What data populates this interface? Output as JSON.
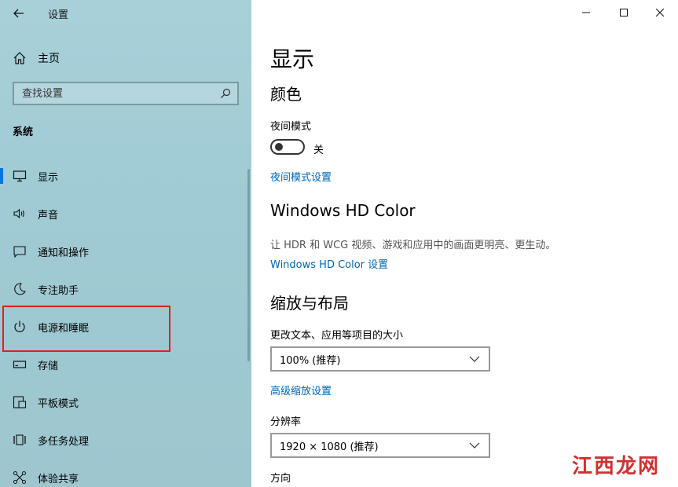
{
  "window": {
    "title": "设置"
  },
  "sidebar": {
    "home_label": "主页",
    "search_placeholder": "查找设置",
    "section_label": "系统",
    "items": [
      {
        "label": "显示",
        "icon": "monitor-icon"
      },
      {
        "label": "声音",
        "icon": "speaker-icon"
      },
      {
        "label": "通知和操作",
        "icon": "notification-icon"
      },
      {
        "label": "专注助手",
        "icon": "moon-icon"
      },
      {
        "label": "电源和睡眠",
        "icon": "power-icon"
      },
      {
        "label": "存储",
        "icon": "storage-icon"
      },
      {
        "label": "平板模式",
        "icon": "tablet-icon"
      },
      {
        "label": "多任务处理",
        "icon": "multitask-icon"
      },
      {
        "label": "体验共享",
        "icon": "share-icon"
      }
    ]
  },
  "main": {
    "page_title": "显示",
    "color_heading": "颜色",
    "night_light_label": "夜间模式",
    "night_light_state": "关",
    "night_light_link": "夜间模式设置",
    "hd_heading": "Windows HD Color",
    "hd_desc": "让 HDR 和 WCG 视频、游戏和应用中的画面更明亮、更生动。",
    "hd_link": "Windows HD Color 设置",
    "scale_heading": "缩放与布局",
    "scale_label": "更改文本、应用等项目的大小",
    "scale_value": "100% (推荐)",
    "advanced_scale_link": "高级缩放设置",
    "resolution_label": "分辨率",
    "resolution_value": "1920 × 1080 (推荐)",
    "orientation_label": "方向"
  },
  "watermark": {
    "text": "江西龙网"
  },
  "colors": {
    "accent": "#0078d7",
    "link": "#0066b4",
    "highlight": "#e02020"
  }
}
